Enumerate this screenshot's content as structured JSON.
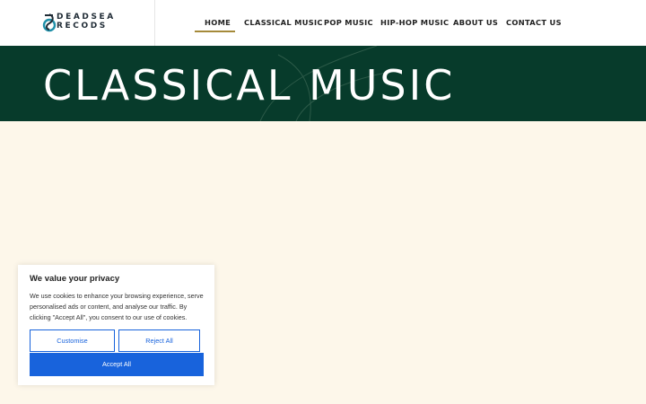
{
  "logo": {
    "line1": "DEADSEA",
    "line2": "RECODS",
    "icon": "treble-clef-logo-icon"
  },
  "nav": {
    "items": [
      {
        "label": "HOME"
      },
      {
        "label": "CLASSICAL MUSIC"
      },
      {
        "label": "POP MUSIC"
      },
      {
        "label": "HIP-HOP MUSIC"
      },
      {
        "label": "ABOUT US"
      },
      {
        "label": "CONTACT US"
      }
    ],
    "active_index": 0
  },
  "banner": {
    "title": "CLASSICAL MUSIC"
  },
  "cookie": {
    "title": "We value your privacy",
    "text": "We use cookies to enhance your browsing experience, serve personalised ads or content, and analyse our traffic. By clicking \"Accept All\", you consent to our use of cookies.",
    "customise_label": "Customise",
    "reject_label": "Reject All",
    "accept_label": "Accept All"
  },
  "colors": {
    "banner_bg": "#073b2b",
    "page_bg": "#fdf7ea",
    "accent_gold": "#a58a3a",
    "button_blue": "#1863dc"
  }
}
